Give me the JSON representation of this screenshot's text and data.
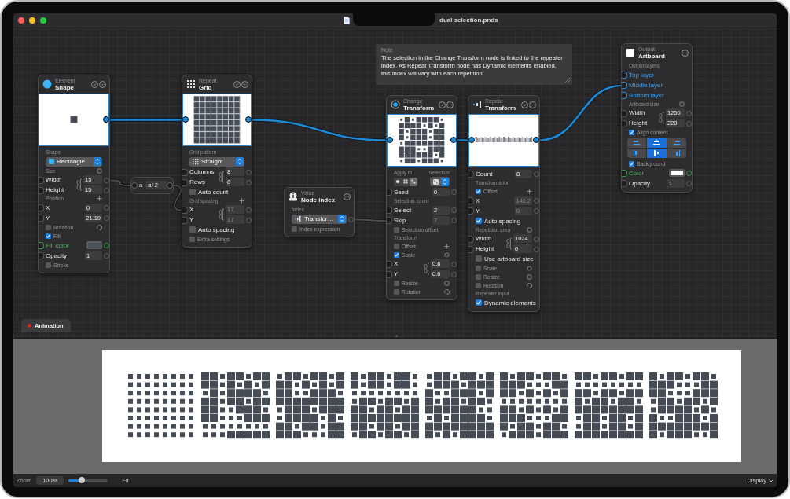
{
  "window": {
    "title": "dual selection.pnds"
  },
  "note": {
    "label": "Note",
    "text": "The selection in the Change Transform node is linked to the repeater index. As Repeat Transform node has Dynamic elements enabled, this index will vary with each repetition."
  },
  "expression": {
    "variable": "a",
    "formula": "a+2"
  },
  "nodes": [
    {
      "category": "Element",
      "title": "Shape",
      "rows": [
        {
          "kind": "preview"
        },
        {
          "kind": "heading",
          "text": "Shape"
        },
        {
          "kind": "dropdown",
          "value": "Rectangle"
        },
        {
          "kind": "heading",
          "text": "Size"
        },
        {
          "kind": "pair",
          "fields": [
            {
              "label": "Width",
              "value": "15",
              "disabled": false
            },
            {
              "label": "Height",
              "value": "15",
              "disabled": false
            }
          ]
        },
        {
          "kind": "heading",
          "text": "Position"
        },
        {
          "kind": "field",
          "label": "X",
          "value": "0",
          "disabled": false
        },
        {
          "kind": "field",
          "label": "Y",
          "value": "21.19",
          "disabled": false
        },
        {
          "kind": "check",
          "label": "Rotation",
          "checked": false,
          "large": false
        },
        {
          "kind": "check",
          "label": "Fill",
          "checked": true,
          "large": false
        },
        {
          "kind": "color",
          "label": "Fill color",
          "color": "#4c535c"
        },
        {
          "kind": "field",
          "label": "Opacity",
          "value": "1",
          "disabled": false
        },
        {
          "kind": "check",
          "label": "Stroke",
          "checked": false,
          "large": false
        }
      ]
    },
    {
      "category": "Repeat",
      "title": "Grid",
      "rows": [
        {
          "kind": "preview"
        },
        {
          "kind": "heading",
          "text": "Grid pattern"
        },
        {
          "kind": "dropdown",
          "value": "Straight"
        },
        {
          "kind": "pair",
          "fields": [
            {
              "label": "Columns",
              "value": "8",
              "disabled": false
            },
            {
              "label": "Rows",
              "value": "8",
              "disabled": false
            }
          ]
        },
        {
          "kind": "check",
          "label": "Auto count",
          "checked": false,
          "large": true
        },
        {
          "kind": "heading",
          "text": "Grid spacing"
        },
        {
          "kind": "pair",
          "fields": [
            {
              "label": "X",
              "value": "17",
              "disabled": true
            },
            {
              "label": "Y",
              "value": "17",
              "disabled": true
            }
          ]
        },
        {
          "kind": "check",
          "label": "Auto spacing",
          "checked": false,
          "large": true
        },
        {
          "kind": "check",
          "label": "Extra settings",
          "checked": false,
          "large": false
        }
      ]
    },
    {
      "category": "Value",
      "title": "Node index",
      "rows": [
        {
          "kind": "heading",
          "text": "Index"
        },
        {
          "kind": "dropdown",
          "value": "Transfor…"
        },
        {
          "kind": "check",
          "label": "Index expression",
          "checked": false,
          "large": false
        }
      ]
    },
    {
      "category": "Change",
      "title": "Transform",
      "rows": [
        {
          "kind": "preview"
        },
        {
          "kind": "heading",
          "text": "Apply to",
          "aside": "Selection"
        },
        {
          "kind": "applyto",
          "options": [
            {
              "selected": false
            },
            {
              "selected": false
            },
            {
              "selected": true
            }
          ]
        },
        {
          "kind": "field",
          "label": "Seed",
          "value": "0",
          "disabled": false
        },
        {
          "kind": "heading",
          "text": "Selection count"
        },
        {
          "kind": "field",
          "label": "Select",
          "value": "2",
          "disabled": false
        },
        {
          "kind": "field",
          "label": "Skip",
          "value": "7",
          "disabled": true
        },
        {
          "kind": "check",
          "label": "Selection offset",
          "checked": false,
          "large": false
        },
        {
          "kind": "heading",
          "text": "Transform"
        },
        {
          "kind": "check",
          "label": "Offset",
          "checked": false,
          "large": false
        },
        {
          "kind": "check",
          "label": "Scale",
          "checked": true,
          "large": false
        },
        {
          "kind": "pair",
          "fields": [
            {
              "label": "X",
              "value": "0.6",
              "disabled": false
            },
            {
              "label": "Y",
              "value": "0.6",
              "disabled": false
            }
          ]
        },
        {
          "kind": "check",
          "label": "Resize",
          "checked": false,
          "large": false
        },
        {
          "kind": "check",
          "label": "Rotation",
          "checked": false,
          "large": false
        }
      ]
    },
    {
      "category": "Repeat",
      "title": "Transform",
      "rows": [
        {
          "kind": "preview"
        },
        {
          "kind": "field",
          "label": "Count",
          "value": "8",
          "disabled": false
        },
        {
          "kind": "heading",
          "text": "Transformation"
        },
        {
          "kind": "check",
          "label": "Offset",
          "checked": true,
          "large": false
        },
        {
          "kind": "field",
          "label": "X",
          "value": "146.2",
          "disabled": true
        },
        {
          "kind": "field",
          "label": "Y",
          "value": "0",
          "disabled": true
        },
        {
          "kind": "check",
          "label": "Auto spacing",
          "checked": true,
          "large": true
        },
        {
          "kind": "heading",
          "text": "Repetition area"
        },
        {
          "kind": "pair",
          "fields": [
            {
              "label": "Width",
              "value": "1024",
              "disabled": false
            },
            {
              "label": "Height",
              "value": "0",
              "disabled": false
            }
          ]
        },
        {
          "kind": "check",
          "label": "Use artboard size",
          "checked": false,
          "large": true
        },
        {
          "kind": "check",
          "label": "Scale",
          "checked": false,
          "large": false
        },
        {
          "kind": "check",
          "label": "Resize",
          "checked": false,
          "large": false
        },
        {
          "kind": "check",
          "label": "Rotation",
          "checked": false,
          "large": false
        },
        {
          "kind": "heading",
          "text": "Repeater input"
        },
        {
          "kind": "check",
          "label": "Dynamic elements",
          "checked": true,
          "large": true
        }
      ]
    },
    {
      "category": "Output",
      "title": "Artboard",
      "rows": [
        {
          "kind": "heading",
          "text": "Output layers"
        },
        {
          "kind": "port",
          "label": "Top layer"
        },
        {
          "kind": "port",
          "label": "Middle layer"
        },
        {
          "kind": "port",
          "label": "Bottom layer"
        },
        {
          "kind": "heading",
          "text": "Artboard size"
        },
        {
          "kind": "pair",
          "fields": [
            {
              "label": "Width",
              "value": "1250",
              "disabled": false
            },
            {
              "label": "Height",
              "value": "220",
              "disabled": false
            }
          ]
        },
        {
          "kind": "check",
          "label": "Align content",
          "checked": true,
          "large": false
        },
        {
          "kind": "align",
          "buttons": [
            {
              "selected": false
            },
            {
              "selected": true
            },
            {
              "selected": false
            },
            {
              "selected": false
            },
            {
              "selected": true
            },
            {
              "selected": false
            }
          ]
        },
        {
          "kind": "check",
          "label": "Background",
          "checked": true,
          "large": false
        },
        {
          "kind": "color",
          "label": "Color",
          "color": "#ffffff"
        },
        {
          "kind": "field",
          "label": "Opacity",
          "value": "1",
          "disabled": false
        }
      ]
    }
  ],
  "animation_tab": {
    "label": "Animation"
  },
  "status_bar": {
    "zoom_label": "Zoom",
    "zoom_value": "100%",
    "slider": {
      "level": 0.33
    },
    "fit": "Fit",
    "display": "Display"
  }
}
